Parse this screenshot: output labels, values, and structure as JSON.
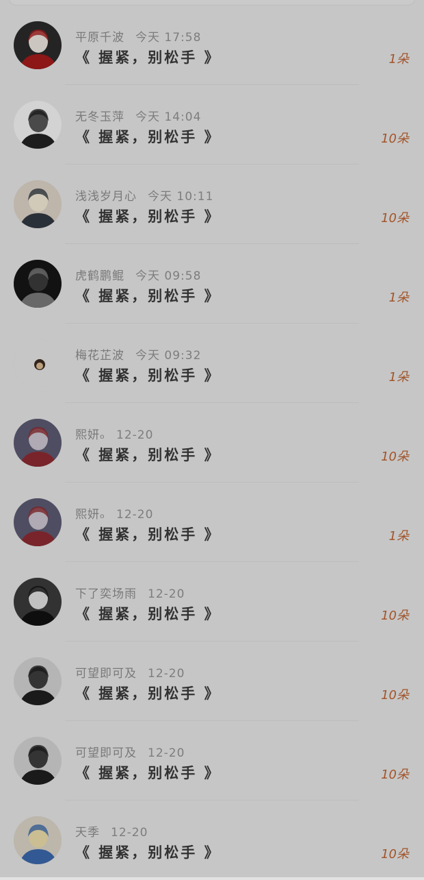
{
  "items": [
    {
      "name": "平原千波",
      "time": "今天 17:58",
      "message": "《 握紧，别松手 》",
      "count": "1朵",
      "avatar_icon": "dark-hair-portrait",
      "bg": "#2a2a2a",
      "fg": "#e9e2dc",
      "accent": "#a11a1a"
    },
    {
      "name": "无冬玉萍",
      "time": "今天 14:04",
      "message": "《 握紧，别松手 》",
      "count": "10朵",
      "avatar_icon": "sketch-girl-portrait",
      "bg": "#f1f1f1",
      "fg": "#555555",
      "accent": "#222222"
    },
    {
      "name": "浅浅岁月心",
      "time": "今天 10:11",
      "message": "《 握紧，别松手 》",
      "count": "10朵",
      "avatar_icon": "blonde-portrait",
      "bg": "#d9cfc3",
      "fg": "#f0e6d2",
      "accent": "#30373f"
    },
    {
      "name": "虎鹤鹏鲲",
      "time": "今天 09:58",
      "message": "《 握紧，别松手 》",
      "count": "1朵",
      "avatar_icon": "dark-silhouette-portrait",
      "bg": "#151515",
      "fg": "#3a3a3a",
      "accent": "#777777"
    },
    {
      "name": "梅花芷波",
      "time": "今天 09:32",
      "message": "《 握紧，别松手 》",
      "count": "1朵",
      "avatar_icon": "small-cartoon",
      "bg": "#e2e2e2",
      "fg": "#3a2a20",
      "accent": "#d8b890"
    },
    {
      "name": "熙妍ₒ",
      "time": "12-20",
      "message": "《 握紧，别松手 》",
      "count": "10朵",
      "avatar_icon": "anime-group",
      "bg": "#5a5870",
      "fg": "#c8c2cc",
      "accent": "#8a2a30"
    },
    {
      "name": "熙妍ₒ",
      "time": "12-20",
      "message": "《 握紧，别松手 》",
      "count": "1朵",
      "avatar_icon": "anime-group",
      "bg": "#5a5870",
      "fg": "#c8c2cc",
      "accent": "#8a2a30"
    },
    {
      "name": "下了奕场雨",
      "time": "12-20",
      "message": "《 握紧，别松手 》",
      "count": "10朵",
      "avatar_icon": "masked-girl-portrait",
      "bg": "#3a3a3a",
      "fg": "#dcdcdc",
      "accent": "#111111"
    },
    {
      "name": "可望即可及",
      "time": "12-20",
      "message": "《 握紧，别松手 》",
      "count": "10朵",
      "avatar_icon": "rider-silhouette",
      "bg": "#cfcfcf",
      "fg": "#3c3c3c",
      "accent": "#1e1e1e"
    },
    {
      "name": "可望即可及",
      "time": "12-20",
      "message": "《 握紧，别松手 》",
      "count": "10朵",
      "avatar_icon": "rider-silhouette",
      "bg": "#cfcfcf",
      "fg": "#3c3c3c",
      "accent": "#1e1e1e"
    },
    {
      "name": "天季",
      "time": "12-20",
      "message": "《 握紧，别松手 》",
      "count": "10朵",
      "avatar_icon": "cartoon-sticker",
      "bg": "#d7d0c3",
      "fg": "#e8d9a8",
      "accent": "#3a66a8"
    }
  ]
}
